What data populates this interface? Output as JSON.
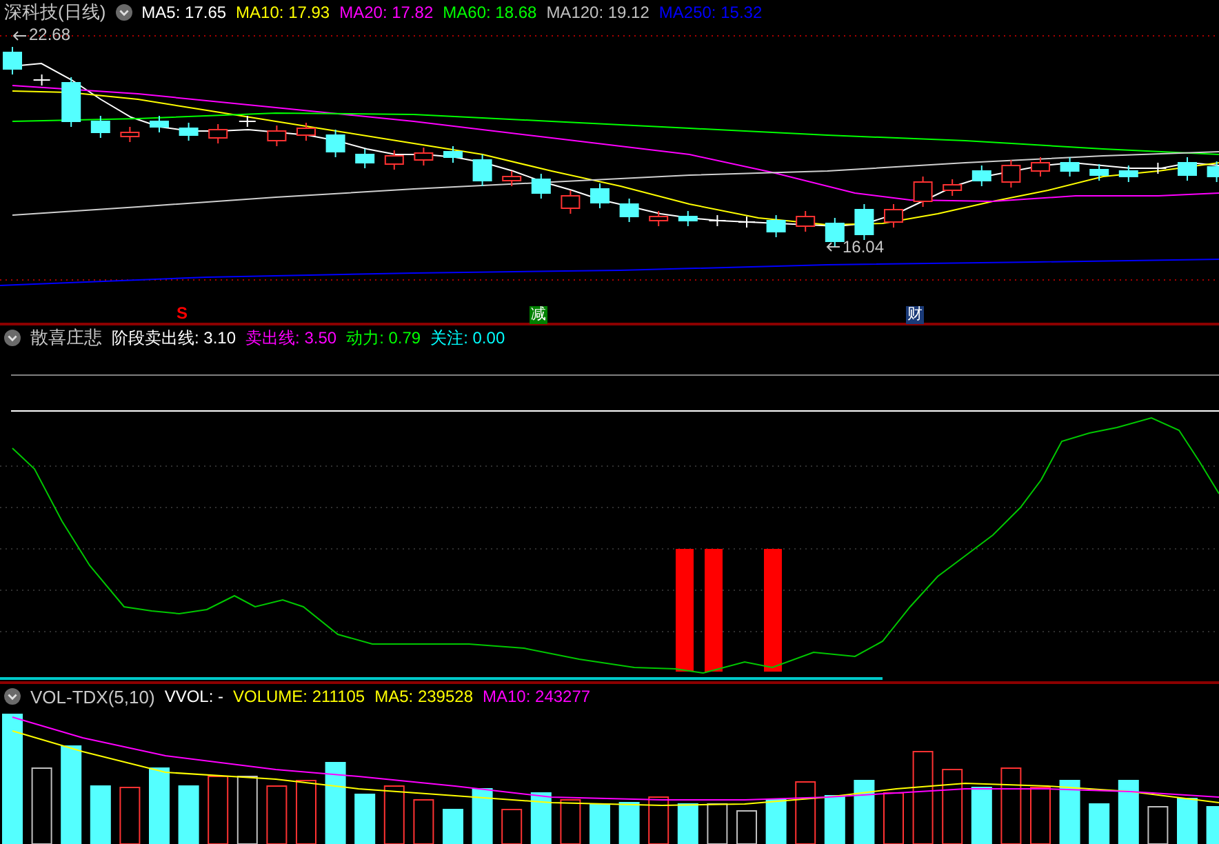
{
  "price_panel": {
    "title": "深科技(日线)",
    "indicators": [
      {
        "text": "MA5: 17.65",
        "color": "#ffffff"
      },
      {
        "text": "MA10: 17.93",
        "color": "#ffff00"
      },
      {
        "text": "MA20: 17.82",
        "color": "#ff00ff"
      },
      {
        "text": "MA60: 18.68",
        "color": "#00ff00"
      },
      {
        "text": "MA120: 19.12",
        "color": "#c0c0c0"
      },
      {
        "text": "MA250: 15.32",
        "color": "#0000ff"
      }
    ],
    "high_label": "22.68",
    "low_label": "16.04",
    "markers": [
      {
        "kind": "text",
        "text": "S",
        "color": "#ff0000"
      },
      {
        "kind": "boxed",
        "text": "减",
        "color": "#008000"
      },
      {
        "kind": "boxed",
        "text": "财",
        "color": "#1a3a78"
      }
    ]
  },
  "indicator_panel": {
    "title": "散喜庄悲",
    "indicators": [
      {
        "text": "阶段卖出线: 3.10",
        "color": "#ffffff"
      },
      {
        "text": "卖出线: 3.50",
        "color": "#ff00ff"
      },
      {
        "text": "动力: 0.79",
        "color": "#00ff00"
      },
      {
        "text": "关注: 0.00",
        "color": "#00ffff"
      }
    ]
  },
  "volume_panel": {
    "title": "VOL-TDX(5,10)",
    "indicators": [
      {
        "text": "VVOL: -",
        "color": "#ffffff"
      },
      {
        "text": "VOLUME: 211105",
        "color": "#ffff00"
      },
      {
        "text": "MA5: 239528",
        "color": "#ffff00"
      },
      {
        "text": "MA10: 243277",
        "color": "#ff00ff"
      }
    ]
  }
}
